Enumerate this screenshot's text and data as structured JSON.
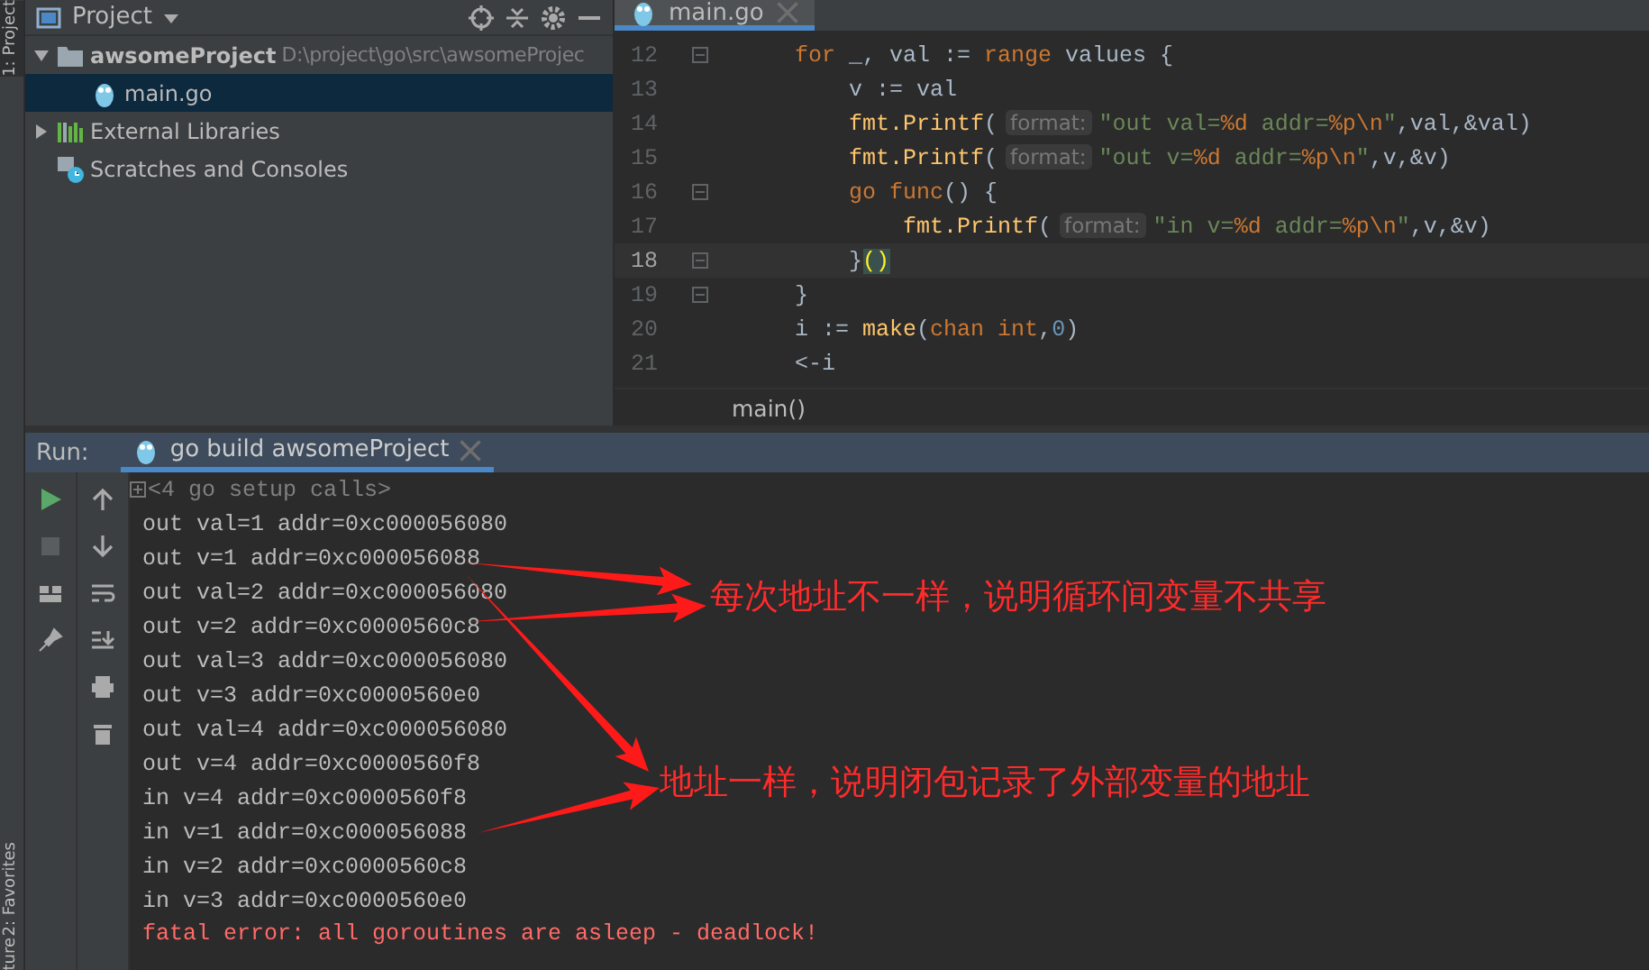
{
  "tool_stripe": {
    "labels": [
      "1: Project",
      "2: Favorites",
      "ture"
    ]
  },
  "project_panel": {
    "title": "Project",
    "tree": [
      {
        "label": "awsomeProject",
        "path": "D:\\project\\go\\src\\awsomeProjec",
        "kind": "folder",
        "expanded": true,
        "selected": false,
        "children": [
          {
            "label": "main.go",
            "kind": "gofile",
            "selected": true
          }
        ]
      },
      {
        "label": "External Libraries",
        "kind": "library",
        "expanded": false,
        "selected": false
      },
      {
        "label": "Scratches and Consoles",
        "kind": "scratch",
        "selected": false
      }
    ]
  },
  "editor": {
    "tabs": [
      {
        "label": "main.go",
        "selected": true
      }
    ],
    "lines": [
      {
        "number": "12",
        "current": false,
        "fold": true,
        "tokens": [
          {
            "text": "    for",
            "kind": "kw"
          },
          {
            "text": " _, val := ",
            "kind": "plain"
          },
          {
            "text": "range",
            "kind": "kw"
          },
          {
            "text": " values {",
            "kind": "plain"
          }
        ]
      },
      {
        "number": "13",
        "current": false,
        "fold": false,
        "tokens": [
          {
            "text": "        v := val",
            "kind": "plain"
          }
        ]
      },
      {
        "number": "14",
        "current": false,
        "fold": false,
        "tokens": [
          {
            "text": "        fmt.Printf",
            "kind": "fn"
          },
          {
            "text": "(",
            "kind": "plain"
          },
          {
            "text": "format:",
            "kind": "hint"
          },
          {
            "text": "\"out val=",
            "kind": "str"
          },
          {
            "text": "%d",
            "kind": "spec"
          },
          {
            "text": " addr=",
            "kind": "str"
          },
          {
            "text": "%p\\n",
            "kind": "spec"
          },
          {
            "text": "\"",
            "kind": "str"
          },
          {
            "text": ",val,&val)",
            "kind": "plain"
          }
        ]
      },
      {
        "number": "15",
        "current": false,
        "fold": false,
        "tokens": [
          {
            "text": "        fmt.Printf",
            "kind": "fn"
          },
          {
            "text": "(",
            "kind": "plain"
          },
          {
            "text": "format:",
            "kind": "hint"
          },
          {
            "text": "\"out v=",
            "kind": "str"
          },
          {
            "text": "%d",
            "kind": "spec"
          },
          {
            "text": " addr=",
            "kind": "str"
          },
          {
            "text": "%p\\n",
            "kind": "spec"
          },
          {
            "text": "\"",
            "kind": "str"
          },
          {
            "text": ",v,&v)",
            "kind": "plain"
          }
        ]
      },
      {
        "number": "16",
        "current": false,
        "fold": true,
        "tokens": [
          {
            "text": "        go func",
            "kind": "kw"
          },
          {
            "text": "() {",
            "kind": "plain"
          }
        ]
      },
      {
        "number": "17",
        "current": false,
        "fold": false,
        "tokens": [
          {
            "text": "            fmt.Printf",
            "kind": "fn"
          },
          {
            "text": "(",
            "kind": "plain"
          },
          {
            "text": "format:",
            "kind": "hint"
          },
          {
            "text": "\"in v=",
            "kind": "str"
          },
          {
            "text": "%d",
            "kind": "spec"
          },
          {
            "text": " addr=",
            "kind": "str"
          },
          {
            "text": "%p\\n",
            "kind": "spec"
          },
          {
            "text": "\"",
            "kind": "str"
          },
          {
            "text": ",v,&v)",
            "kind": "plain"
          }
        ]
      },
      {
        "number": "18",
        "current": true,
        "fold": true,
        "tokens": [
          {
            "text": "        }",
            "kind": "plain"
          },
          {
            "text": "()",
            "kind": "match"
          }
        ]
      },
      {
        "number": "19",
        "current": false,
        "fold": true,
        "tokens": [
          {
            "text": "    }",
            "kind": "plain"
          }
        ]
      },
      {
        "number": "20",
        "current": false,
        "fold": false,
        "tokens": [
          {
            "text": "    i := ",
            "kind": "plain"
          },
          {
            "text": "make",
            "kind": "fn"
          },
          {
            "text": "(",
            "kind": "plain"
          },
          {
            "text": "chan int",
            "kind": "kw"
          },
          {
            "text": ",",
            "kind": "plain"
          },
          {
            "text": "0",
            "kind": "num"
          },
          {
            "text": ")",
            "kind": "plain"
          }
        ]
      },
      {
        "number": "21",
        "current": false,
        "fold": false,
        "tokens": [
          {
            "text": "    <-i",
            "kind": "plain"
          }
        ]
      }
    ],
    "breadcrumb": "main()"
  },
  "run_panel": {
    "label": "Run:",
    "tabs": [
      {
        "label": "go build awsomeProject",
        "selected": true
      }
    ],
    "output": [
      {
        "text": "<4 go setup calls>",
        "kind": "fold"
      },
      {
        "text": "out val=1 addr=0xc000056080",
        "kind": "normal"
      },
      {
        "text": "out v=1 addr=0xc000056088",
        "kind": "normal"
      },
      {
        "text": "out val=2 addr=0xc000056080",
        "kind": "normal"
      },
      {
        "text": "out v=2 addr=0xc0000560c8",
        "kind": "normal"
      },
      {
        "text": "out val=3 addr=0xc000056080",
        "kind": "normal"
      },
      {
        "text": "out v=3 addr=0xc0000560e0",
        "kind": "normal"
      },
      {
        "text": "out val=4 addr=0xc000056080",
        "kind": "normal"
      },
      {
        "text": "out v=4 addr=0xc0000560f8",
        "kind": "normal"
      },
      {
        "text": "in v=4 addr=0xc0000560f8",
        "kind": "normal"
      },
      {
        "text": "in v=1 addr=0xc000056088",
        "kind": "normal"
      },
      {
        "text": "in v=2 addr=0xc0000560c8",
        "kind": "normal"
      },
      {
        "text": "in v=3 addr=0xc0000560e0",
        "kind": "normal"
      },
      {
        "text": "fatal error: all goroutines are asleep - deadlock!",
        "kind": "error"
      }
    ]
  },
  "annotations": [
    {
      "text": "每次地址不一样，说明循环间变量不共享"
    },
    {
      "text": "地址一样，说明闭包记录了外部变量的地址"
    }
  ]
}
